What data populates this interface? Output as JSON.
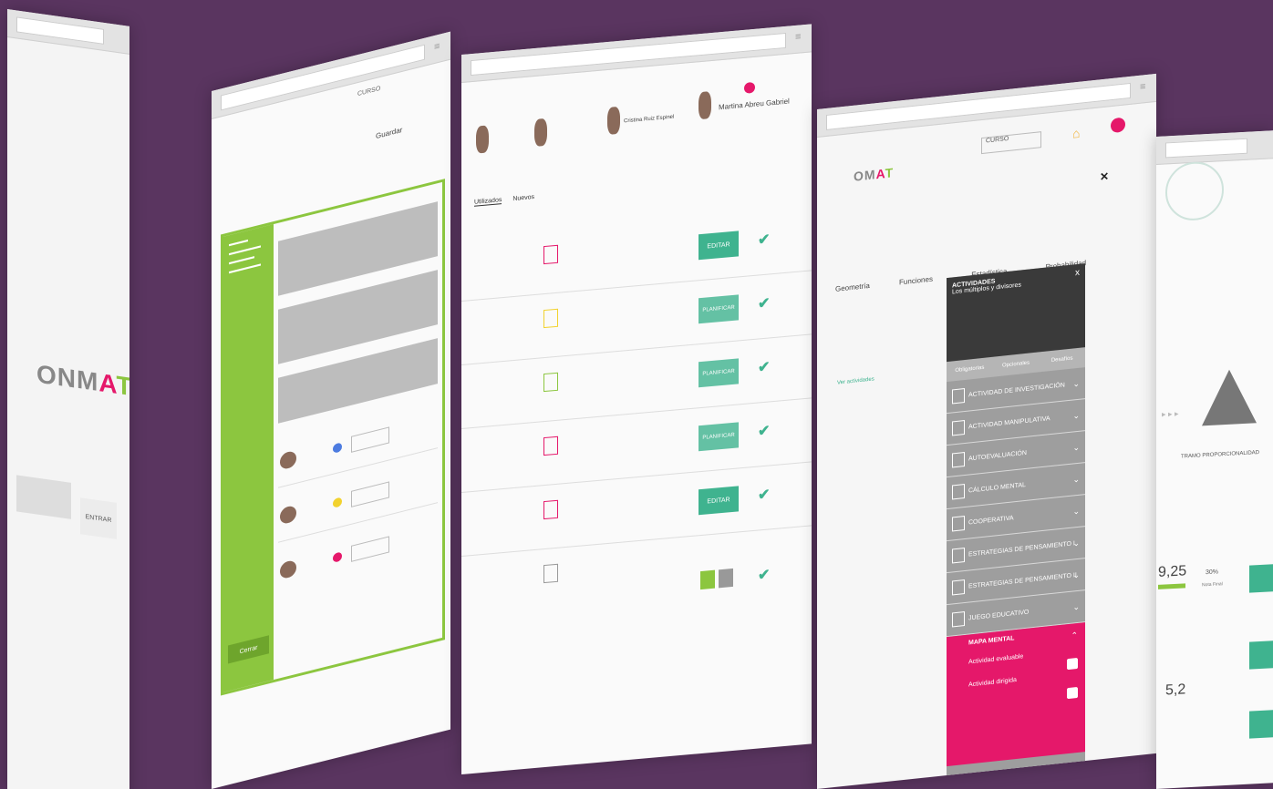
{
  "screen1": {
    "logo": {
      "o": "O",
      "n": "N",
      "m": "M",
      "a": "A",
      "t": "T"
    },
    "button": "ENTRAR"
  },
  "screen2": {
    "course": "CURSO",
    "tab": "Guardar",
    "green_panel": {
      "button": "Cerrar"
    }
  },
  "screen3": {
    "tabs": [
      "Utilizados",
      "Nuevos"
    ],
    "buttons": [
      "EDITAR",
      "PLANIFICAR",
      "PLANIFICAR",
      "PLANIFICAR",
      "EDITAR"
    ],
    "name": "Martina Abreu Gabriel",
    "person_name": "Cristina Ruiz Espinel"
  },
  "screen4": {
    "course_select": "CURSO",
    "tabs": [
      "Geometría",
      "Funciones",
      "Estadística",
      "Probabilidad"
    ],
    "see_activities": "Ver actividades",
    "panel": {
      "title": "ACTIVIDADES",
      "subtitle": "Los múltiplos y divisores",
      "tabs": [
        "Obligatorias",
        "Opcionales",
        "Desafíos"
      ],
      "items": [
        "ACTIVIDAD DE INVESTIGACIÓN",
        "ACTIVIDAD MANIPULATIVA",
        "AUTOEVALUACIÓN",
        "CÁLCULO MENTAL",
        "COOPERATIVA",
        "ESTRATEGIAS DE PENSAMIENTO I",
        "ESTRATEGIAS DE PENSAMIENTO II",
        "JUEGO EDUCATIVO"
      ],
      "highlight": {
        "title": "MAPA MENTAL",
        "sub1": "Actividad evaluable",
        "sub2": "Actividad dirigida"
      },
      "close": "x"
    }
  },
  "screen5": {
    "scores": [
      "9,25",
      "5,2"
    ],
    "percent": "30%",
    "label": "Nota Final",
    "tramo": "TRAMO PROPORCIONALIDAD"
  },
  "colors": {
    "background": "#5a3560",
    "green": "#8cc63f",
    "magenta": "#e5186a",
    "teal": "#3fb38f",
    "dark": "#3a3a3a"
  }
}
